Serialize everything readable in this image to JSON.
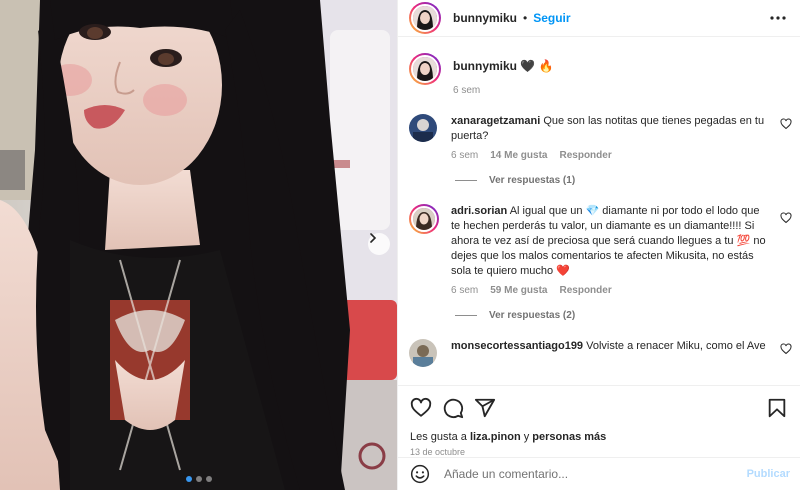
{
  "header": {
    "username": "bunnymiku",
    "separator": "•",
    "follow_label": "Seguir",
    "more_icon": "more-horizontal-icon"
  },
  "caption": {
    "username": "bunnymiku",
    "emoji": "🖤 🔥",
    "time": "6 sem"
  },
  "comments": [
    {
      "username": "xanaragetzamani",
      "text": "Que son las notitas que tienes pegadas en tu puerta?",
      "time": "6 sem",
      "likes": "14 Me gusta",
      "reply_label": "Responder",
      "view_replies": "Ver respuestas (1)"
    },
    {
      "username": "adri.sorian",
      "text": "Al igual que un 💎 diamante ni por todo el lodo que te hechen perderás tu valor, un diamante es un diamante!!!! Si ahora te vez así de preciosa que será cuando llegues a tu 💯 no dejes que los malos comentarios te afecten Mikusita, no estás sola te quiero mucho ❤️",
      "time": "6 sem",
      "likes": "59 Me gusta",
      "reply_label": "Responder",
      "view_replies": "Ver respuestas (2)"
    },
    {
      "username": "monsecortessantiago199",
      "text": "Volviste a renacer Miku, como el Ave"
    }
  ],
  "likes": {
    "prefix": "Les gusta a",
    "user": "liza.pinon",
    "middle": "y",
    "rest": "personas más"
  },
  "date": "13 de octubre",
  "add_comment": {
    "placeholder": "Añade un comentario...",
    "publish_label": "Publicar"
  },
  "carousel": {
    "count": 3,
    "active": 1
  },
  "colors": {
    "accent": "#0095f6",
    "publish_disabled": "#b3dbff",
    "heart": "#ff0000"
  }
}
